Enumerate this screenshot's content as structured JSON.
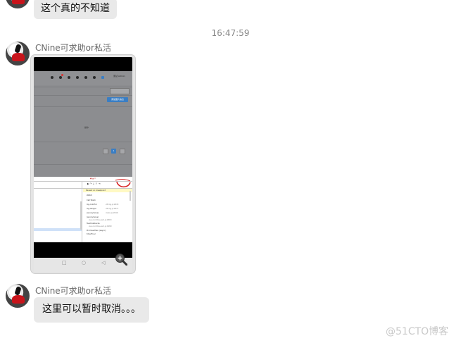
{
  "messages": {
    "first_bubble": "这个真的不知道",
    "timestamp": "16:47:59",
    "sender_1": "CNine可求助or私活",
    "sender_2": "CNine可求助or私活",
    "last_bubble": "这里可以暂时取消。。。"
  },
  "screenshot": {
    "topbar_user": "测试 Admin",
    "primary_button": "添加图片信息",
    "center_text": "操作",
    "page_number": "1",
    "devtools": {
      "banner": "Paused on breakpoint",
      "section_watch": "Watch",
      "section_callstack": "Call Stack",
      "stack": [
        {
          "fn": "log.colorful",
          "loc": "v8-log.js:2643"
        },
        {
          "fn": "log.danger",
          "loc": "v8-log.js:2677"
        },
        {
          "fn": "(anonymous)",
          "loc": "index.js:2649"
        },
        {
          "fn": "(anonymous)",
          "loc": "vue.runtime.esm.js:1863"
        },
        {
          "fn": "flushCallbacks",
          "loc": "vue.runtime.esm.js:1989"
        },
        {
          "fn": "Promise.then (async)",
          "loc": ""
        },
        {
          "fn": "timerFunc",
          "loc": ""
        }
      ]
    }
  },
  "watermark": "@51CTO博客",
  "icons": {
    "zoom": "zoom-in-icon",
    "avatar": "user-avatar"
  },
  "colors": {
    "bubble_bg": "#e9e9e9",
    "annotation_red": "#d62020",
    "primary_blue": "#3a7ec4"
  }
}
